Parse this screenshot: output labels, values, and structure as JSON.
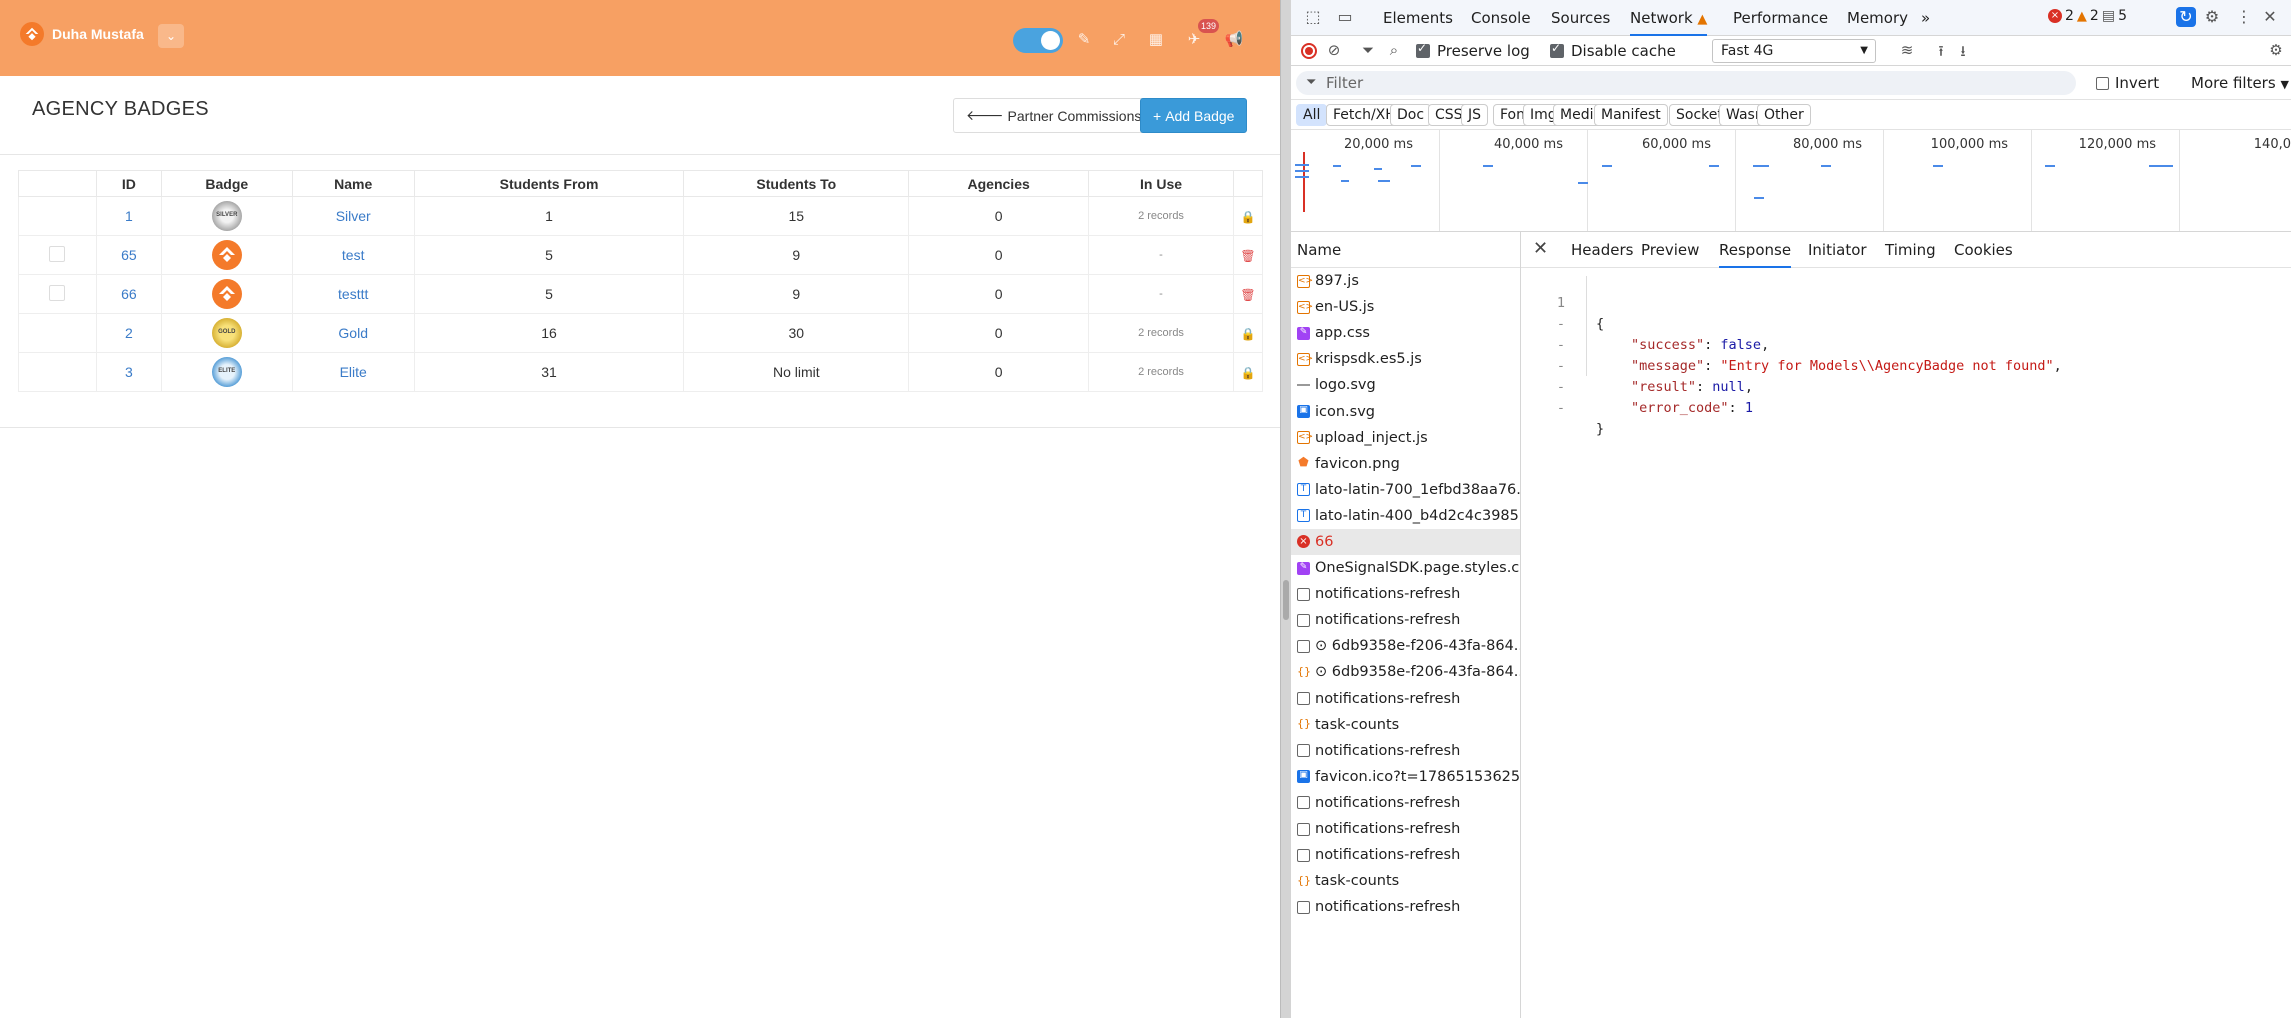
{
  "app": {
    "user_name": "Duha Mustafa",
    "dropdown_glyph": "⌄",
    "notification_count": "139",
    "page_title": "AGENCY BADGES",
    "partner_button": "Partner Commissions",
    "add_button": "Add Badge",
    "table": {
      "headers": [
        "",
        "ID",
        "Badge",
        "Name",
        "Students From",
        "Students To",
        "Agencies",
        "In Use",
        ""
      ],
      "rows": [
        {
          "id": "1",
          "badge": "silver",
          "badge_text": "SILVER",
          "name": "Silver",
          "from": "1",
          "to": "15",
          "agencies": "0",
          "in_use": "2 records",
          "action": "lock",
          "checkbox": false
        },
        {
          "id": "65",
          "badge": "orange",
          "badge_text": "",
          "name": "test",
          "from": "5",
          "to": "9",
          "agencies": "0",
          "in_use": "-",
          "action": "trash",
          "checkbox": true
        },
        {
          "id": "66",
          "badge": "orange",
          "badge_text": "",
          "name": "testtt",
          "from": "5",
          "to": "9",
          "agencies": "0",
          "in_use": "-",
          "action": "trash",
          "checkbox": true
        },
        {
          "id": "2",
          "badge": "gold",
          "badge_text": "GOLD",
          "name": "Gold",
          "from": "16",
          "to": "30",
          "agencies": "0",
          "in_use": "2 records",
          "action": "lock",
          "checkbox": false
        },
        {
          "id": "3",
          "badge": "elite",
          "badge_text": "ELITE",
          "name": "Elite",
          "from": "31",
          "to": "No limit",
          "agencies": "0",
          "in_use": "2 records",
          "action": "lock",
          "checkbox": false
        }
      ]
    },
    "colors": {
      "topbar": "#f7a063",
      "primary": "#3a9ad9",
      "link": "#3a7bc8",
      "danger": "#e04b4b"
    }
  },
  "devtools": {
    "tabs": [
      "Elements",
      "Console",
      "Sources",
      "Network",
      "Performance",
      "Memory"
    ],
    "active_tab": "Network",
    "more_tabs_glyph": "»",
    "errors": "2",
    "warnings": "2",
    "messages": "5",
    "preserve_log": "Preserve log",
    "disable_cache": "Disable cache",
    "throttle": "Fast 4G",
    "filter_placeholder": "Filter",
    "invert": "Invert",
    "more_filters": "More filters",
    "type_filters": [
      "All",
      "Fetch/XHR",
      "Doc",
      "CSS",
      "JS",
      "Font",
      "Img",
      "Media",
      "Manifest",
      "Socket",
      "Wasm",
      "Other"
    ],
    "timeline_labels": [
      "20,000 ms",
      "40,000 ms",
      "60,000 ms",
      "80,000 ms",
      "100,000 ms",
      "120,000 ms",
      "140,0"
    ],
    "name_header": "Name",
    "requests": [
      {
        "name": "897.js",
        "type": "js"
      },
      {
        "name": "en-US.js",
        "type": "js"
      },
      {
        "name": "app.css",
        "type": "css"
      },
      {
        "name": "krispsdk.es5.js",
        "type": "js"
      },
      {
        "name": "logo.svg",
        "type": "svg"
      },
      {
        "name": "icon.svg",
        "type": "img"
      },
      {
        "name": "upload_inject.js",
        "type": "js"
      },
      {
        "name": "favicon.png",
        "type": "fav"
      },
      {
        "name": "lato-latin-700_1efbd38aa76...",
        "type": "font"
      },
      {
        "name": "lato-latin-400_b4d2c4c3985...",
        "type": "font"
      },
      {
        "name": "66",
        "type": "err"
      },
      {
        "name": "OneSignalSDK.page.styles.c...",
        "type": "css"
      },
      {
        "name": "notifications-refresh",
        "type": "doc"
      },
      {
        "name": "notifications-refresh",
        "type": "doc"
      },
      {
        "name": "⊙ 6db9358e-f206-43fa-864...",
        "type": "doc"
      },
      {
        "name": "⊙ 6db9358e-f206-43fa-864...",
        "type": "xhr"
      },
      {
        "name": "notifications-refresh",
        "type": "doc"
      },
      {
        "name": "task-counts",
        "type": "xhr"
      },
      {
        "name": "notifications-refresh",
        "type": "doc"
      },
      {
        "name": "favicon.ico?t=17865153625...",
        "type": "img"
      },
      {
        "name": "notifications-refresh",
        "type": "doc"
      },
      {
        "name": "notifications-refresh",
        "type": "doc"
      },
      {
        "name": "notifications-refresh",
        "type": "doc"
      },
      {
        "name": "task-counts",
        "type": "xhr"
      },
      {
        "name": "notifications-refresh",
        "type": "doc"
      }
    ],
    "selected_request": "66",
    "detail_tabs": [
      "Headers",
      "Preview",
      "Response",
      "Initiator",
      "Timing",
      "Cookies"
    ],
    "active_detail_tab": "Response",
    "response": {
      "line_numbers": [
        "1",
        "-",
        "-",
        "-",
        "-",
        "-"
      ],
      "open": "{",
      "close": "}",
      "success_key": "\"success\"",
      "success_val": "false",
      "message_key": "\"message\"",
      "message_val": "\"Entry for Models\\\\AgencyBadge not found\"",
      "result_key": "\"result\"",
      "result_val": "null",
      "error_key": "\"error_code\"",
      "error_val": "1"
    }
  }
}
